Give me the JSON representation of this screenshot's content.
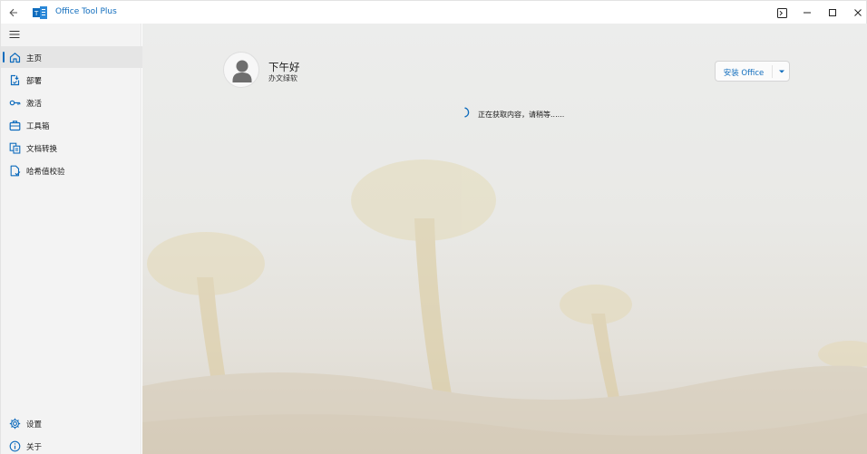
{
  "window": {
    "title": "Office Tool Plus",
    "icons": {
      "back": "back-arrow-icon",
      "logo": "office-tool-plus-logo",
      "terminal": "terminal-icon",
      "minimize": "minimize-icon",
      "maximize": "maximize-icon",
      "close": "close-icon"
    }
  },
  "sidebar": {
    "menu_icon": "hamburger-icon",
    "items": [
      {
        "label": "主页",
        "icon": "home-icon",
        "active": true
      },
      {
        "label": "部署",
        "icon": "deploy-icon",
        "active": false
      },
      {
        "label": "激活",
        "icon": "key-icon",
        "active": false
      },
      {
        "label": "工具箱",
        "icon": "toolbox-icon",
        "active": false
      },
      {
        "label": "文档转换",
        "icon": "document-convert-icon",
        "active": false
      },
      {
        "label": "哈希值校验",
        "icon": "hash-check-icon",
        "active": false
      }
    ],
    "footer_items": [
      {
        "label": "设置",
        "icon": "gear-icon"
      },
      {
        "label": "关于",
        "icon": "info-icon"
      }
    ]
  },
  "main": {
    "greeting": "下午好",
    "user_name": "办文绿软",
    "install_button": {
      "label": "安装 Office",
      "icon": "chevron-down-icon"
    },
    "loading_text": "正在获取内容，请稍等......"
  },
  "colors": {
    "accent": "#0f6cbd",
    "sidebar_bg": "#f3f3f3",
    "active_item_bg": "#e5e5e5"
  }
}
